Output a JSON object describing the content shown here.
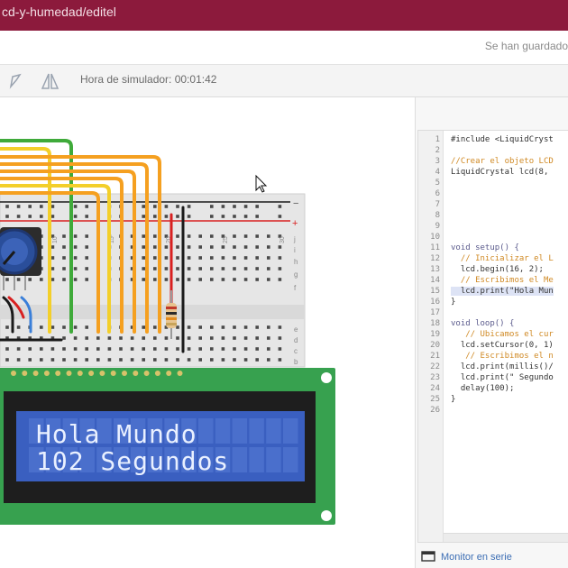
{
  "url": {
    "text": "cd-y-humedad/editel"
  },
  "header": {
    "save_status": "Se han guardado"
  },
  "toolbar": {
    "sim_time": "Hora de simulador: 00:01:42"
  },
  "lcd": {
    "line1": "Hola Mundo",
    "line2": "102 Segundos"
  },
  "breadboard": {
    "columns": [
      "5",
      "10",
      "15",
      "20",
      "25",
      "30"
    ],
    "right_labels": [
      "f",
      "g",
      "h",
      "i",
      "j"
    ],
    "right_labels_bottom": [
      "e",
      "d",
      "c",
      "b",
      "a"
    ],
    "rail_minus": "−",
    "rail_plus": "+"
  },
  "code": {
    "lines": [
      {
        "n": "1",
        "text": "#include <LiquidCryst",
        "kind": "plain"
      },
      {
        "n": "2",
        "text": "",
        "kind": "plain"
      },
      {
        "n": "3",
        "text": "//Crear el objeto LCD",
        "kind": "comment"
      },
      {
        "n": "4",
        "text": "LiquidCrystal lcd(8,",
        "kind": "plain"
      },
      {
        "n": "5",
        "text": "",
        "kind": "plain"
      },
      {
        "n": "6",
        "text": "",
        "kind": "plain"
      },
      {
        "n": "7",
        "text": "",
        "kind": "plain"
      },
      {
        "n": "8",
        "text": "",
        "kind": "plain"
      },
      {
        "n": "9",
        "text": "",
        "kind": "plain"
      },
      {
        "n": "10",
        "text": "",
        "kind": "plain"
      },
      {
        "n": "11",
        "text": "void setup() {",
        "kind": "keyword"
      },
      {
        "n": "12",
        "text": "  // Inicializar el L",
        "kind": "comment"
      },
      {
        "n": "13",
        "text": "  lcd.begin(16, 2);",
        "kind": "plain"
      },
      {
        "n": "14",
        "text": "  // Escribimos el Me",
        "kind": "comment"
      },
      {
        "n": "15",
        "text": "  lcd.print(\"Hola Mun",
        "kind": "plain"
      },
      {
        "n": "16",
        "text": "}",
        "kind": "plain"
      },
      {
        "n": "17",
        "text": "",
        "kind": "plain"
      },
      {
        "n": "18",
        "text": "void loop() {",
        "kind": "keyword"
      },
      {
        "n": "19",
        "text": "   // Ubicamos el cur",
        "kind": "comment"
      },
      {
        "n": "20",
        "text": "  lcd.setCursor(0, 1)",
        "kind": "plain"
      },
      {
        "n": "21",
        "text": "   // Escribimos el n",
        "kind": "comment"
      },
      {
        "n": "22",
        "text": "  lcd.print(millis()/",
        "kind": "plain"
      },
      {
        "n": "23",
        "text": "  lcd.print(\" Segundo",
        "kind": "plain"
      },
      {
        "n": "24",
        "text": "  delay(100);",
        "kind": "plain"
      },
      {
        "n": "25",
        "text": "}",
        "kind": "plain"
      },
      {
        "n": "26",
        "text": "",
        "kind": "plain"
      }
    ]
  },
  "footer": {
    "serial_monitor": "Monitor en serie"
  },
  "colors": {
    "brand": "#8c1a3c",
    "lcd_bg": "#3a5fc0",
    "pcb_green": "#37a14f",
    "wire_orange": "#f5a020",
    "wire_yellow": "#f3cf2a",
    "wire_green": "#3faa3a"
  }
}
